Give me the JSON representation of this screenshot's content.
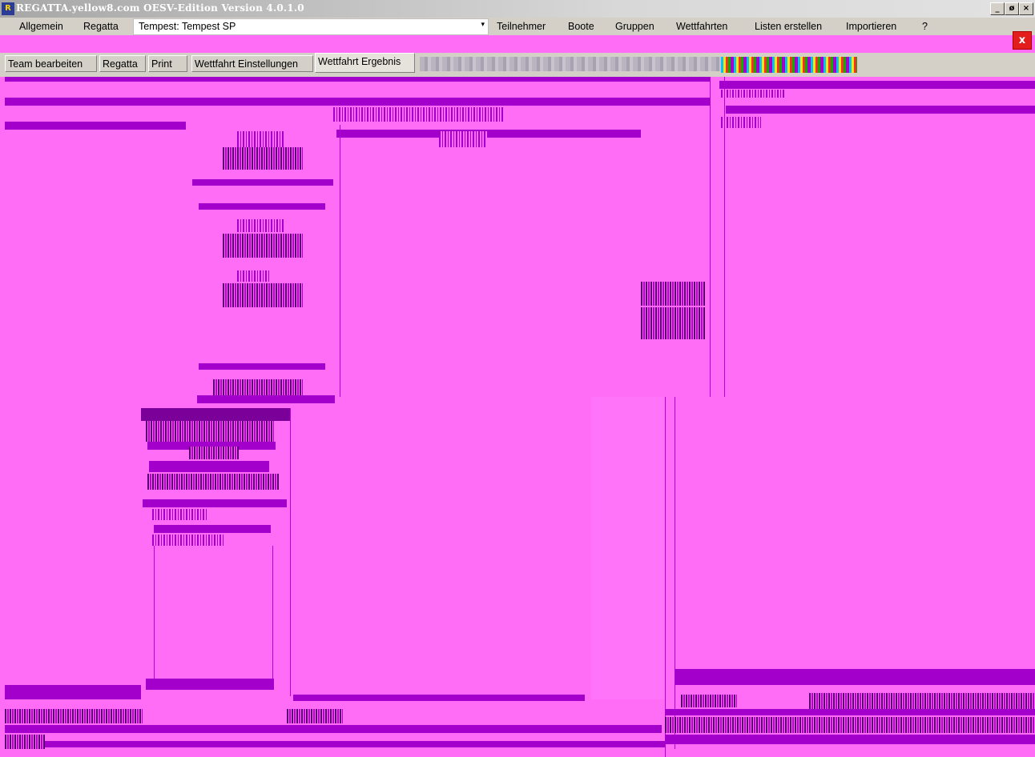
{
  "window": {
    "title": "REGATTA.yellow8.com OESV-Edition Version 4.0.1.0",
    "icon": "regatta-app-icon",
    "controls": [
      "_",
      "ø",
      "×"
    ]
  },
  "menu": {
    "items": [
      "Allgemein",
      "Regatta"
    ],
    "combo_label": "Tempest:",
    "combo_value": "Tempest SP",
    "right_items": [
      "Teilnehmer",
      "Boote",
      "Gruppen",
      "Wettfahrten",
      "Listen erstellen",
      "Importieren",
      "?"
    ],
    "close_label": "x"
  },
  "tabs": {
    "items": [
      "Team bearbeiten",
      "Regatta",
      "Print",
      "Wettfahrt Einstellungen",
      "Wettfahrt Ergebnis"
    ],
    "active": "Wettfahrt Ergebnis"
  },
  "colors": {
    "background": "#ff6cf5",
    "artifact": "#a300cc",
    "chrome": "#d4d0c8",
    "close_button": "#e31c1c"
  }
}
